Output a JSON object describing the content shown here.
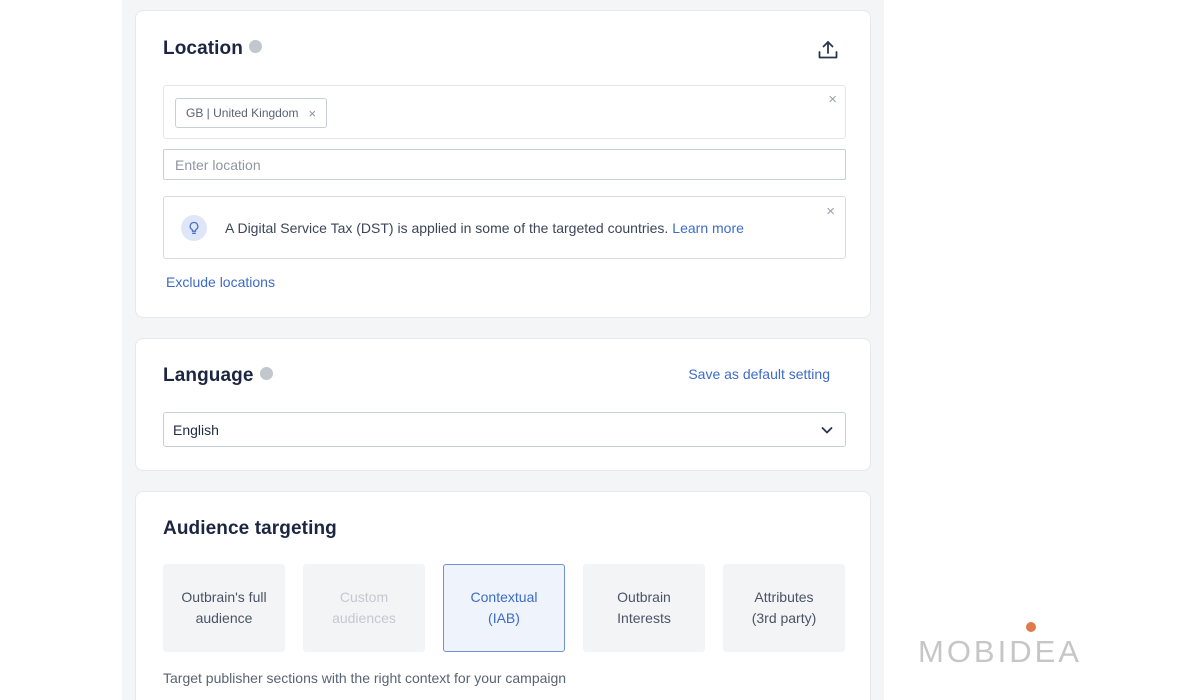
{
  "location": {
    "title": "Location",
    "chips": [
      {
        "label": "GB | United Kingdom",
        "remove": "×"
      }
    ],
    "clear_all": "×",
    "input_placeholder": "Enter location",
    "notice": {
      "text": "A Digital Service Tax (DST) is applied in some of the targeted countries.",
      "link": "Learn more",
      "close": "×"
    },
    "exclude_link": "Exclude locations",
    "icons": {
      "info": "info-icon",
      "upload": "upload-icon",
      "bulb": "lightbulb-icon"
    }
  },
  "language": {
    "title": "Language",
    "save_default": "Save as default setting",
    "selected": "English",
    "icons": {
      "info": "info-icon",
      "chevron": "chevron-down-icon"
    }
  },
  "audience": {
    "title": "Audience targeting",
    "options": [
      {
        "label": "Outbrain's full\naudience",
        "state": "default"
      },
      {
        "label": "Custom\naudiences",
        "state": "disabled"
      },
      {
        "label": "Contextual\n(IAB)",
        "state": "selected"
      },
      {
        "label": "Outbrain\nInterests",
        "state": "default"
      },
      {
        "label": "Attributes\n(3rd party)",
        "state": "default"
      }
    ],
    "description": "Target publisher sections with the right context for your campaign"
  },
  "watermark": {
    "text": "MOBIDEA",
    "dot_color": "#e07a4a"
  },
  "colors": {
    "link": "#3d6bc7",
    "selected_border": "#6d93d6",
    "title": "#1c2541"
  }
}
